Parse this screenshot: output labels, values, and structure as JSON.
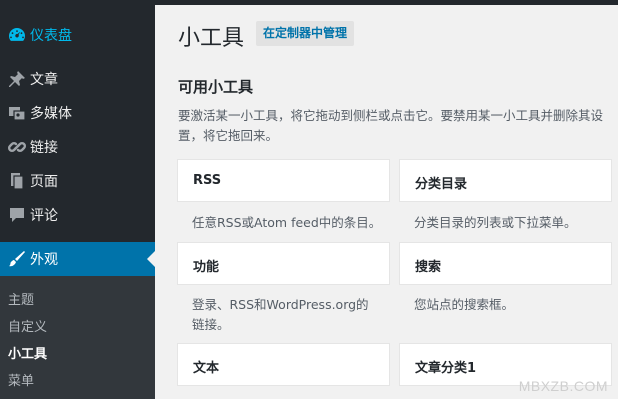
{
  "sidebar": {
    "dashboard": {
      "label": "仪表盘",
      "icon": "dashboard-icon"
    },
    "items": [
      {
        "label": "文章",
        "icon": "pushpin-icon"
      },
      {
        "label": "多媒体",
        "icon": "media-icon"
      },
      {
        "label": "链接",
        "icon": "link-icon"
      },
      {
        "label": "页面",
        "icon": "pages-icon"
      },
      {
        "label": "评论",
        "icon": "comment-icon"
      }
    ],
    "appearance": {
      "label": "外观",
      "icon": "paintbrush-icon"
    },
    "submenu": [
      "主题",
      "自定义",
      "小工具",
      "菜单"
    ],
    "current_submenu": "小工具"
  },
  "header": {
    "title": "小工具",
    "manage_button": "在定制器中管理"
  },
  "available": {
    "title": "可用小工具",
    "description": "要激活某一小工具，将它拖动到侧栏或点击它。要禁用某一小工具并删除其设置，将它拖回来。"
  },
  "widgets": [
    {
      "title": "RSS",
      "desc": "任意RSS或Atom feed中的条目。"
    },
    {
      "title": "分类目录",
      "desc": "分类目录的列表或下拉菜单。"
    },
    {
      "title": "功能",
      "desc": "登录、RSS和WordPress.org的链接。"
    },
    {
      "title": "搜索",
      "desc": "您站点的搜索框。"
    },
    {
      "title": "文本",
      "desc": ""
    },
    {
      "title": "文章分类1",
      "desc": ""
    }
  ],
  "watermark": "MBXZB.COM",
  "colors": {
    "sidebar_bg": "#23282d",
    "submenu_bg": "#32373c",
    "active_bg": "#0073aa",
    "dashboard_accent": "#00b9eb",
    "content_bg": "#f1f1f1"
  }
}
